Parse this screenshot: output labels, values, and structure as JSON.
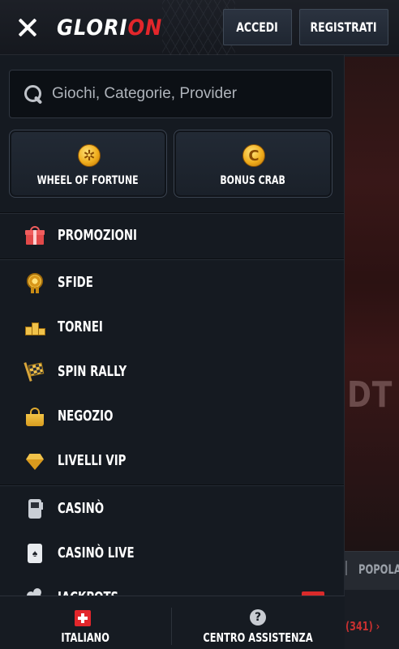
{
  "header": {
    "logo_left": "GLORI",
    "logo_right": "ON",
    "login_label": "ACCEDI",
    "register_label": "REGISTRATI"
  },
  "search": {
    "placeholder": "Giochi, Categorie, Provider"
  },
  "tiles": [
    {
      "label": "WHEEL OF FORTUNE",
      "icon": "wheel-coin-icon"
    },
    {
      "label": "BONUS CRAB",
      "icon": "crab-coin-icon"
    }
  ],
  "menu": {
    "promo": {
      "label": "PROMOZIONI",
      "icon": "gift-icon"
    },
    "rewards": [
      {
        "label": "SFIDE",
        "icon": "medal-icon"
      },
      {
        "label": "TORNEI",
        "icon": "podium-icon"
      },
      {
        "label": "SPIN RALLY",
        "icon": "checkered-flag-icon"
      },
      {
        "label": "NEGOZIO",
        "icon": "shopping-bag-icon"
      },
      {
        "label": "LIVELLI VIP",
        "icon": "diamond-icon"
      }
    ],
    "games": [
      {
        "label": "CASINÒ",
        "icon": "slot-machine-icon"
      },
      {
        "label": "CASINÒ LIVE",
        "icon": "playing-card-icon"
      },
      {
        "label": "JACKPOTS",
        "icon": "clover-icon"
      }
    ]
  },
  "background": {
    "banner_text": "DT",
    "tab_label": "POPOLARI",
    "more_text": "(341) ›"
  },
  "footer": {
    "language_label": "ITALIANO",
    "help_label": "CENTRO ASSISTENZA"
  },
  "colors": {
    "accent_red": "#e3262b",
    "gold": "#f0ad1c",
    "drawer_bg": "#151a21"
  }
}
